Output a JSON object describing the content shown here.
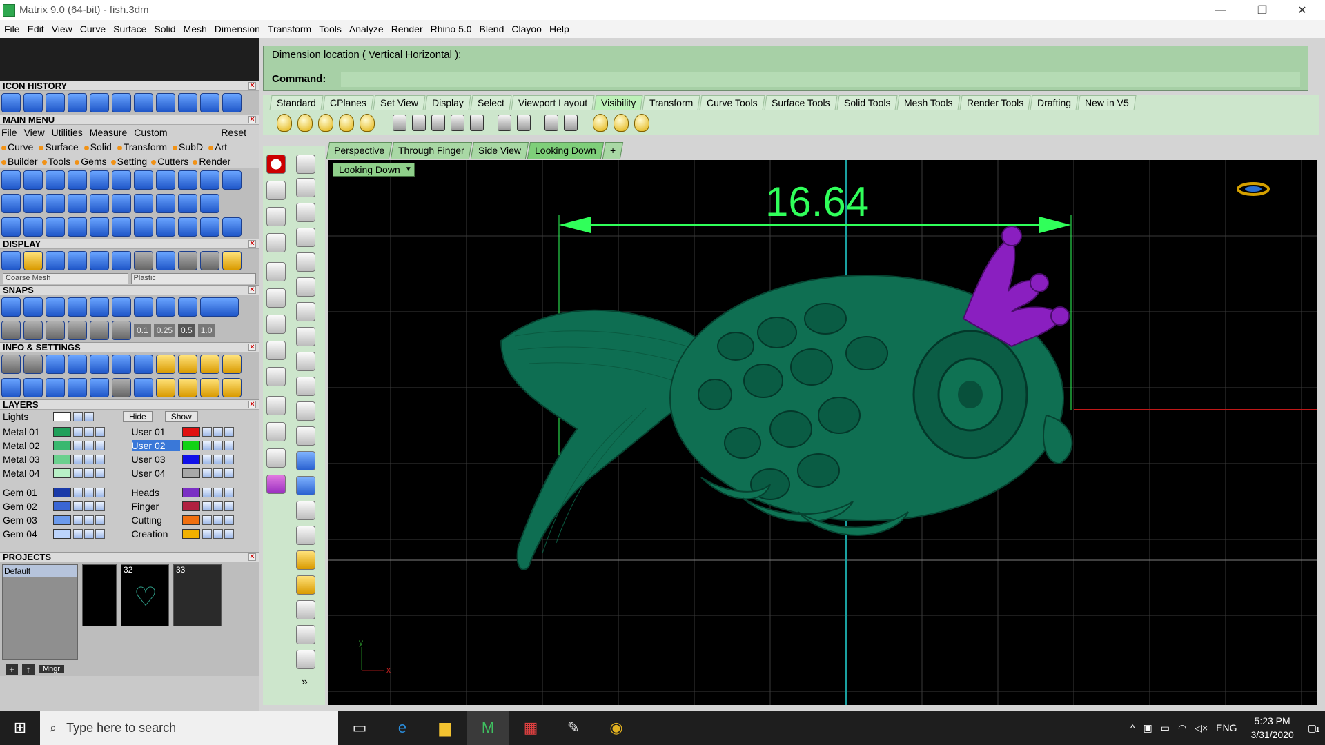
{
  "titlebar": {
    "title": "Matrix 9.0 (64-bit) - fish.3dm",
    "minimize": "—",
    "restore": "❐",
    "close": "✕"
  },
  "menubar": [
    "File",
    "Edit",
    "View",
    "Curve",
    "Surface",
    "Solid",
    "Mesh",
    "Dimension",
    "Transform",
    "Tools",
    "Analyze",
    "Render",
    "Rhino 5.0",
    "Blend",
    "Clayoo",
    "Help"
  ],
  "panels": {
    "icon_history": "ICON HISTORY",
    "main_menu": "MAIN MENU",
    "main_menu_items": [
      "File",
      "View",
      "Utilities",
      "Measure",
      "Custom"
    ],
    "reset": "Reset",
    "mm_row1": [
      "Curve",
      "Surface",
      "Solid",
      "Transform",
      "SubD",
      "Art"
    ],
    "mm_row2": [
      "Builder",
      "Tools",
      "Gems",
      "Setting",
      "Cutters",
      "Render"
    ],
    "display": "DISPLAY",
    "display_mesh": "Coarse Mesh",
    "display_material": "Plastic",
    "snaps": "SNAPS",
    "snap_values": [
      "0.1",
      "0.25",
      "0.5",
      "1.0"
    ],
    "info_settings": "INFO & SETTINGS",
    "layers": "LAYERS",
    "lights": "Lights",
    "hide": "Hide",
    "show": "Show",
    "layers_left": [
      {
        "name": "Metal 01",
        "color": "#1fa05a"
      },
      {
        "name": "Metal 02",
        "color": "#39b86f"
      },
      {
        "name": "Metal 03",
        "color": "#6ad08e"
      },
      {
        "name": "Metal 04",
        "color": "#b8f0c6"
      },
      {
        "name": "Gem 01",
        "color": "#1a3aa8"
      },
      {
        "name": "Gem 02",
        "color": "#3a66d4"
      },
      {
        "name": "Gem 03",
        "color": "#6b9aec"
      },
      {
        "name": "Gem 04",
        "color": "#bcd4fb"
      }
    ],
    "layers_right": [
      {
        "name": "User 01",
        "color": "#e01010"
      },
      {
        "name": "User 02",
        "color": "#12d214"
      },
      {
        "name": "User 03",
        "color": "#1010e8"
      },
      {
        "name": "User 04",
        "color": "#a8a8a8"
      },
      {
        "name": "Heads",
        "color": "#7a2fc4"
      },
      {
        "name": "Finger",
        "color": "#b02040"
      },
      {
        "name": "Cutting",
        "color": "#f07010"
      },
      {
        "name": "Creation",
        "color": "#f0b000"
      }
    ],
    "projects": "PROJECTS",
    "project_default": "Default",
    "project_nums": [
      "32",
      "33"
    ],
    "mngr": "Mngr"
  },
  "command": {
    "prompt_line": "Dimension location ( Vertical  Horizontal ):",
    "command_label": "Command:",
    "command_value": ""
  },
  "toolbar_tabs": [
    "Standard",
    "CPlanes",
    "Set View",
    "Display",
    "Select",
    "Viewport Layout",
    "Visibility",
    "Transform",
    "Curve Tools",
    "Surface Tools",
    "Solid Tools",
    "Mesh Tools",
    "Render Tools",
    "Drafting",
    "New in V5"
  ],
  "active_toolbar_tab": "Visibility",
  "viewport_tabs": [
    "Perspective",
    "Through Finger",
    "Side View",
    "Looking Down"
  ],
  "active_viewport": "Looking Down",
  "add_tab": "+",
  "viewport": {
    "title": "Looking Down",
    "dimension": "16.64",
    "axis_y": "y",
    "axis_x": "x"
  },
  "taskbar": {
    "search_placeholder": "Type here to search",
    "time": "5:23 PM",
    "date": "3/31/2020",
    "lang": "ENG",
    "notifications": "1"
  },
  "colors": {
    "command_bg": "#a7d0a6",
    "dim_color": "#30ff5a",
    "fish": "#0c6b4e",
    "crown": "#8a1fc0"
  }
}
